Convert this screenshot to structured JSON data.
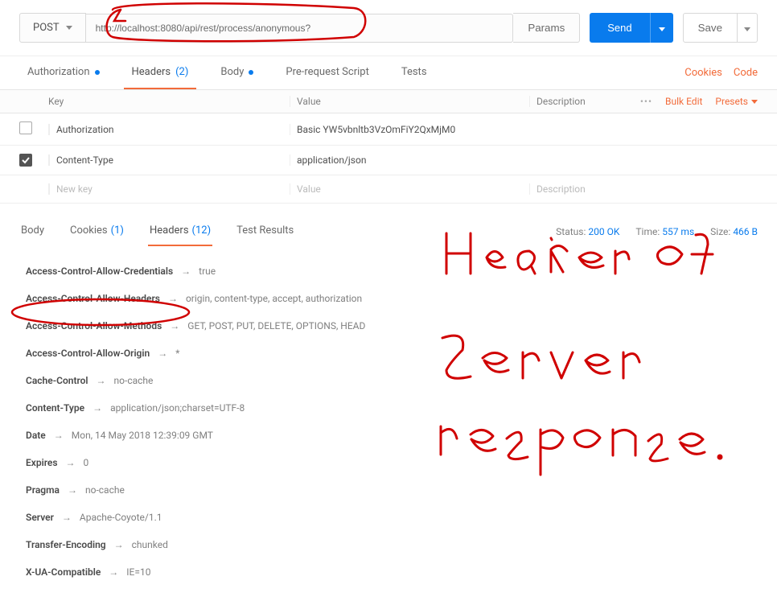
{
  "request": {
    "method": "POST",
    "url": "http://localhost:8080/api/rest/process/anonymous?",
    "params_label": "Params",
    "send_label": "Send",
    "save_label": "Save"
  },
  "req_tabs": {
    "authorization": "Authorization",
    "headers": "Headers",
    "headers_count": "(2)",
    "body": "Body",
    "prerequest": "Pre-request Script",
    "tests": "Tests",
    "cookies": "Cookies",
    "code": "Code"
  },
  "table": {
    "key_label": "Key",
    "value_label": "Value",
    "desc_label": "Description",
    "more": "•••",
    "bulk_edit": "Bulk Edit",
    "presets": "Presets",
    "rows": [
      {
        "checked": false,
        "key": "Authorization",
        "value": "Basic YW5vbnltb3VzOmFiY2QxMjM0",
        "desc": ""
      },
      {
        "checked": true,
        "key": "Content-Type",
        "value": "application/json",
        "desc": ""
      }
    ],
    "ghost_key": "New key",
    "ghost_value": "Value",
    "ghost_desc": "Description"
  },
  "resp_tabs": {
    "body": "Body",
    "cookies": "Cookies",
    "cookies_count": "(1)",
    "headers": "Headers",
    "headers_count": "(12)",
    "tests": "Test Results"
  },
  "status": {
    "status_label": "Status:",
    "status_value": "200 OK",
    "time_label": "Time:",
    "time_value": "557 ms",
    "size_label": "Size:",
    "size_value": "466 B"
  },
  "response_headers": [
    {
      "key": "Access-Control-Allow-Credentials",
      "value": "true"
    },
    {
      "key": "Access-Control-Allow-Headers",
      "value": "origin, content-type, accept, authorization"
    },
    {
      "key": "Access-Control-Allow-Methods",
      "value": "GET, POST, PUT, DELETE, OPTIONS, HEAD"
    },
    {
      "key": "Access-Control-Allow-Origin",
      "value": "*"
    },
    {
      "key": "Cache-Control",
      "value": "no-cache"
    },
    {
      "key": "Content-Type",
      "value": "application/json;charset=UTF-8"
    },
    {
      "key": "Date",
      "value": "Mon, 14 May 2018 12:39:09 GMT"
    },
    {
      "key": "Expires",
      "value": "0"
    },
    {
      "key": "Pragma",
      "value": "no-cache"
    },
    {
      "key": "Server",
      "value": "Apache-Coyote/1.1"
    },
    {
      "key": "Transfer-Encoding",
      "value": "chunked"
    },
    {
      "key": "X-UA-Compatible",
      "value": "IE=10"
    }
  ],
  "annotations": {
    "handwriting": "Header of server response."
  }
}
